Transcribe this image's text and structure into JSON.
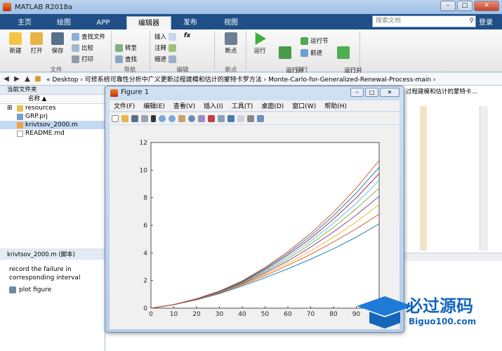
{
  "window": {
    "title": "MATLAB R2018a",
    "controls": [
      "–",
      "□",
      "✕"
    ]
  },
  "tabs": [
    {
      "label": "主页",
      "active": false
    },
    {
      "label": "绘图",
      "active": false
    },
    {
      "label": "APP",
      "active": false
    },
    {
      "label": "编辑器",
      "active": true
    },
    {
      "label": "发布",
      "active": false
    },
    {
      "label": "视图",
      "active": false
    }
  ],
  "search": {
    "placeholder": "搜索文档"
  },
  "login_label": "登录",
  "ribbon": {
    "new": "新建",
    "open": "打开",
    "save": "保存",
    "find_files": "查找文件",
    "compare": "比较",
    "print": "打印",
    "goto": "转至",
    "find": "查找",
    "insert": "插入",
    "comment": "注释",
    "indent": "缩进",
    "fx": "fx",
    "breakpoint": "断点",
    "run": "运行",
    "run_advance": "运行并\n前进",
    "run_section": "运行节",
    "advance": "前进",
    "run_time": "运行并\n计时",
    "groups": {
      "file": "文件",
      "nav": "导航",
      "edit": "编辑",
      "bp": "断点",
      "run": "运行"
    }
  },
  "address": {
    "path": "«  Desktop  ›  可修系统可靠性分析中广义更新过程建模和估计的蒙特卡罗方法  ›  Monte-Carlo-for-Generalized-Renewal-Process-main  ›"
  },
  "current_folder": {
    "title": "当前文件夹",
    "column": "名称 ▲",
    "files": [
      {
        "name": "resources",
        "type": "folder",
        "selected": false
      },
      {
        "name": "GRP.prj",
        "type": "project",
        "selected": false
      },
      {
        "name": "krivtsov_2000.m",
        "type": "script",
        "selected": true
      },
      {
        "name": "README.md",
        "type": "text",
        "selected": false
      }
    ]
  },
  "details": {
    "title": "krivtsov_2000.m  (脚本)",
    "comment": "record the failure in corresponding interval",
    "item": "plot figure"
  },
  "editor_tab": "过程建模和估计的蒙特卡...",
  "figure": {
    "title": "Figure 1",
    "menu": [
      "文件(F)",
      "编辑(E)",
      "查看(V)",
      "插入(I)",
      "工具(T)",
      "桌面(D)",
      "窗口(W)",
      "帮助(H)"
    ]
  },
  "watermark": {
    "cn": "必过源码",
    "url": "Biguo100.com"
  },
  "colors": {
    "tabbar": "#1f4f86",
    "accent": "#0072bd"
  },
  "chart_data": {
    "type": "line",
    "x": [
      0,
      10,
      20,
      30,
      40,
      50,
      60,
      70,
      80,
      90,
      100
    ],
    "xticks": [
      0,
      10,
      20,
      30,
      40,
      50,
      60,
      70,
      80,
      90
    ],
    "yticks": [
      0,
      2,
      4,
      6,
      8,
      10,
      12
    ],
    "xlim": [
      0,
      100
    ],
    "ylim": [
      0,
      12
    ],
    "grid": false,
    "series": [
      {
        "color": "#0072bd",
        "values": [
          0,
          0.25,
          0.6,
          1.05,
          1.6,
          2.2,
          2.85,
          3.55,
          4.3,
          5.15,
          6.1
        ]
      },
      {
        "color": "#d95319",
        "values": [
          0,
          0.25,
          0.62,
          1.1,
          1.68,
          2.35,
          3.1,
          3.9,
          4.8,
          5.75,
          6.8
        ]
      },
      {
        "color": "#edb120",
        "values": [
          0,
          0.25,
          0.63,
          1.12,
          1.72,
          2.45,
          3.25,
          4.15,
          5.15,
          6.25,
          7.5
        ]
      },
      {
        "color": "#7e2f8e",
        "values": [
          0,
          0.25,
          0.64,
          1.14,
          1.77,
          2.55,
          3.42,
          4.42,
          5.52,
          6.75,
          8.1
        ]
      },
      {
        "color": "#77ac30",
        "values": [
          0,
          0.26,
          0.65,
          1.16,
          1.82,
          2.65,
          3.58,
          4.65,
          5.85,
          7.2,
          8.7
        ]
      },
      {
        "color": "#4dbeee",
        "values": [
          0,
          0.26,
          0.66,
          1.18,
          1.86,
          2.72,
          3.72,
          4.85,
          6.15,
          7.6,
          9.25
        ]
      },
      {
        "color": "#a2142f",
        "values": [
          0,
          0.26,
          0.67,
          1.2,
          1.9,
          2.8,
          3.86,
          5.06,
          6.45,
          8.0,
          9.75
        ]
      },
      {
        "color": "#0072bd",
        "values": [
          0,
          0.26,
          0.68,
          1.22,
          1.94,
          2.88,
          3.98,
          5.25,
          6.7,
          8.35,
          10.2
        ]
      },
      {
        "color": "#d95319",
        "values": [
          0,
          0.27,
          0.69,
          1.24,
          1.98,
          2.95,
          4.1,
          5.42,
          6.95,
          8.7,
          10.7
        ]
      }
    ]
  }
}
